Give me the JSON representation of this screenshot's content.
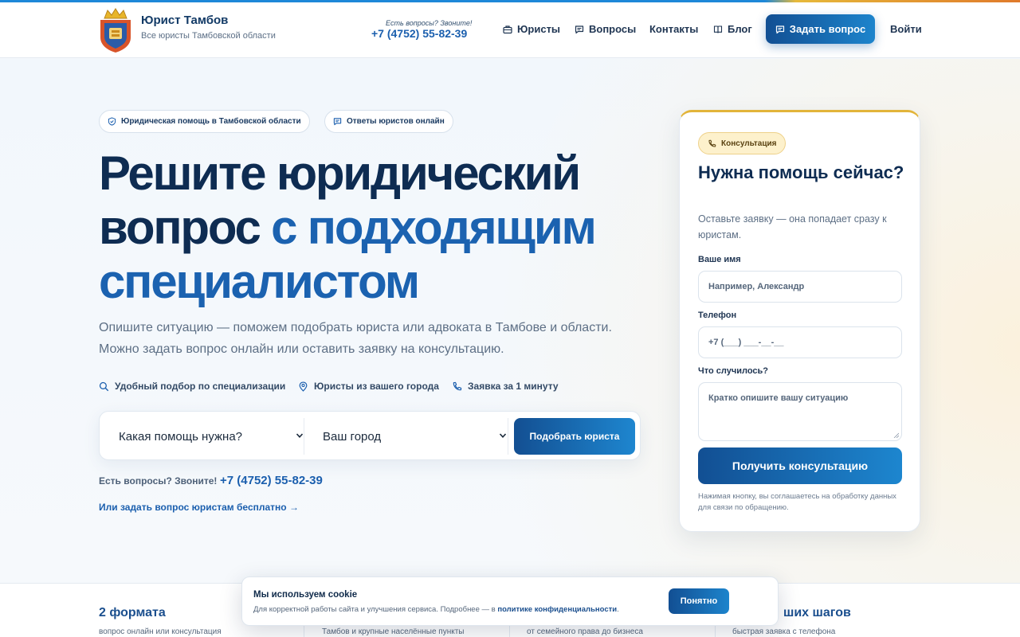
{
  "header": {
    "brand_title": "Юрист Тамбов",
    "brand_subtitle": "Все юристы Тамбовской области",
    "phone_label": "Есть вопросы? Звоните!",
    "phone": "+7 (4752) 55-82-39",
    "nav": [
      {
        "label": "Юристы",
        "icon": "briefcase-icon"
      },
      {
        "label": "Вопросы",
        "icon": "message-icon"
      },
      {
        "label": "Контакты",
        "icon": ""
      },
      {
        "label": "Блог",
        "icon": "book-icon"
      }
    ],
    "ask_button": "Задать вопрос",
    "login": "Войти"
  },
  "hero": {
    "chips": [
      {
        "label": "Юридическая помощь в Тамбовской области",
        "icon": "shield-icon"
      },
      {
        "label": "Ответы юристов онлайн",
        "icon": "message-icon"
      }
    ],
    "title_part1": "Решите юридический",
    "title_part2": "вопрос",
    "title_accent1": "с подходящим",
    "title_accent2": "специалистом",
    "lead_line1": "Опишите ситуацию — поможем подобрать юриста или адвоката в Тамбове и области.",
    "lead_line2": "Можно задать вопрос онлайн или оставить заявку на консультацию.",
    "features": [
      {
        "label": "Удобный подбор по специализации",
        "icon": "search-icon"
      },
      {
        "label": "Юристы из вашего города",
        "icon": "map-pin-icon"
      },
      {
        "label": "Заявка за 1 минуту",
        "icon": "phone-icon"
      }
    ],
    "search": {
      "help_select": "Какая помощь нужна?",
      "city_select": "Ваш город",
      "button": "Подобрать юриста"
    },
    "question_label": "Есть вопросы? Звоните!",
    "question_phone": "+7 (4752) 55-82-39",
    "free_link": "Или задать вопрос юристам бесплатно →"
  },
  "form": {
    "badge": "Консультация",
    "title": "Нужна помощь сейчас?",
    "subtitle": "Оставьте заявку — она попадает сразу к юристам.",
    "name_label": "Ваше имя",
    "name_placeholder": "Например, Александр",
    "phone_label": "Телефон",
    "phone_placeholder": "+7 (___) ___-__-__",
    "problem_label": "Что случилось?",
    "problem_placeholder": "Кратко опишите вашу ситуацию",
    "submit": "Получить консультацию",
    "note": "Нажимая кнопку, вы соглашаетесь на обработку данных для связи по обращению."
  },
  "stats": [
    {
      "title": "2 формата",
      "sub": "вопрос онлайн или консультация"
    },
    {
      "title": "",
      "sub": "Тамбов и крупные населённые пункты"
    },
    {
      "title": "",
      "sub": "от семейного права до бизнеса"
    },
    {
      "title": "ших шагов",
      "sub": "быстрая заявка с телефона"
    }
  ],
  "cookie": {
    "title": "Мы используем cookie",
    "text_before": "Для корректной работы сайта и улучшения сервиса. Подробнее — в ",
    "link": "политике конфиденциальности",
    "text_after": ".",
    "button": "Понятно"
  },
  "colors": {
    "brand_blue": "#1b5fae",
    "dark_navy": "#0e2c52",
    "accent_gold": "#e2b43a"
  }
}
